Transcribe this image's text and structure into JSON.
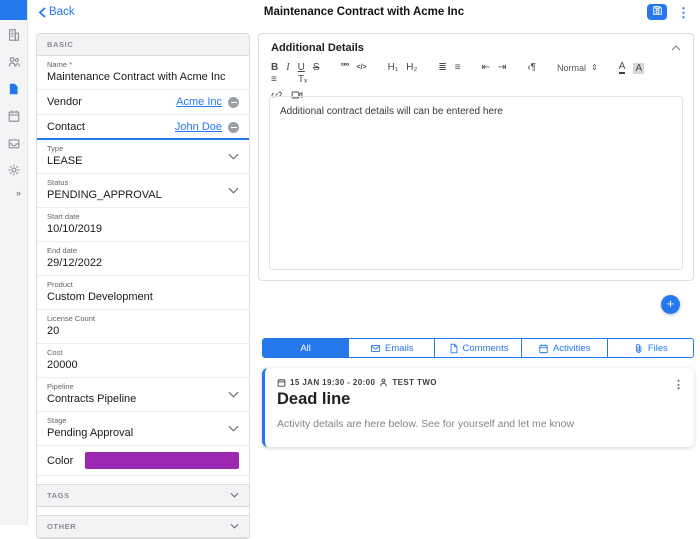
{
  "colors": {
    "accent": "#2478ec",
    "stage_color": "#9c27b0"
  },
  "glyphs": {
    "kebab": "⋮",
    "plus": "+",
    "expand": "»"
  },
  "header": {
    "back_label": "Back",
    "title": "Maintenance Contract with Acme Inc"
  },
  "sidebar": {
    "items": [
      {
        "name": "companies",
        "active": false
      },
      {
        "name": "contacts",
        "active": false
      },
      {
        "name": "documents",
        "active": true
      },
      {
        "name": "calendar",
        "active": false
      },
      {
        "name": "inbox",
        "active": false
      },
      {
        "name": "settings",
        "active": false
      }
    ]
  },
  "form": {
    "sections": {
      "basic": "BASIC",
      "tags": "TAGS",
      "other": "OTHER"
    },
    "fields": [
      {
        "type": "input",
        "label": "Name *",
        "value": "Maintenance Contract with Acme Inc"
      },
      {
        "type": "link",
        "label": "Vendor",
        "value": "Acme Inc",
        "focused": false
      },
      {
        "type": "link",
        "label": "Contact",
        "value": "John Doe",
        "focused": true
      },
      {
        "type": "select",
        "label": "Type",
        "value": "LEASE"
      },
      {
        "type": "select",
        "label": "Status",
        "value": "PENDING_APPROVAL"
      },
      {
        "type": "input",
        "label": "Start date",
        "value": "10/10/2019"
      },
      {
        "type": "input",
        "label": "End date",
        "value": "29/12/2022"
      },
      {
        "type": "input",
        "label": "Product",
        "value": "Custom Development"
      },
      {
        "type": "input",
        "label": "License Count",
        "value": "20"
      },
      {
        "type": "input",
        "label": "Cost",
        "value": "20000"
      },
      {
        "type": "select",
        "label": "Pipeline",
        "value": "Contracts Pipeline"
      },
      {
        "type": "select",
        "label": "Stage",
        "value": "Pending Approval"
      },
      {
        "type": "color",
        "label": "Color",
        "value": "#9c27b0"
      }
    ]
  },
  "details": {
    "title": "Additional Details",
    "content": "Additional contract details will can be entered here",
    "toolbar": [
      [
        [
          {
            "name": "bold-icon",
            "glyph": "B",
            "cls": "g-b"
          },
          {
            "name": "italic-icon",
            "glyph": "I",
            "cls": "g-i"
          },
          {
            "name": "underline-icon",
            "glyph": "U",
            "cls": "g-u"
          },
          {
            "name": "strike-icon",
            "glyph": "S",
            "cls": "g-s"
          }
        ],
        [
          {
            "name": "blockquote-icon",
            "glyph": "””",
            "cls": "g-q"
          },
          {
            "name": "code-icon",
            "glyph": "</>",
            "cls": "g-c"
          }
        ],
        [
          {
            "name": "heading1-icon",
            "glyph": "H₁"
          },
          {
            "name": "heading2-icon",
            "glyph": "H₂"
          }
        ],
        [
          {
            "name": "ordered-list-icon",
            "glyph": "≣"
          },
          {
            "name": "bullet-list-icon",
            "glyph": "≡"
          }
        ],
        [
          {
            "name": "outdent-icon",
            "glyph": "⇤"
          },
          {
            "name": "indent-icon",
            "glyph": "⇥"
          }
        ],
        [
          {
            "name": "text-direction-icon",
            "glyph": "‹¶"
          }
        ],
        [
          {
            "name": "format-select",
            "glyph": "Normal",
            "cls": "g-fmt",
            "suffix": "⇕"
          }
        ],
        [
          {
            "name": "text-color-icon",
            "glyph": "A",
            "cls": "g-color"
          },
          {
            "name": "highlight-color-icon",
            "glyph": "A",
            "cls": "g-bg"
          }
        ],
        [
          {
            "name": "align-icon",
            "glyph": "≡"
          }
        ],
        [
          {
            "name": "clear-format-icon",
            "glyph": "Tₓ"
          }
        ]
      ],
      [
        [
          {
            "name": "link-icon",
            "svg": "link"
          },
          {
            "name": "video-icon",
            "svg": "video"
          }
        ]
      ]
    ]
  },
  "tabs": [
    {
      "label": "All",
      "icon": null,
      "active": true
    },
    {
      "label": "Emails",
      "icon": "email",
      "active": false
    },
    {
      "label": "Comments",
      "icon": "comment",
      "active": false
    },
    {
      "label": "Activities",
      "icon": "activity",
      "active": false
    },
    {
      "label": "Files",
      "icon": "paperclip",
      "active": false
    }
  ],
  "activity": {
    "datetime": "15 JAN 19:30 - 20:00",
    "user": "TEST TWO",
    "title": "Dead line",
    "body": "Activity details are here below. See for yourself and let me know"
  }
}
